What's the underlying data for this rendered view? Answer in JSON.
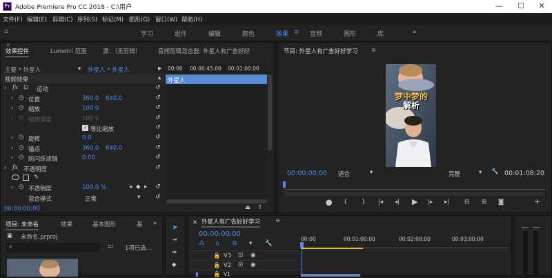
{
  "titlebar": {
    "title": "Adobe Premiere Pro CC 2018 - C:\\用户",
    "app_icon": "Pr",
    "minimize": "—",
    "maximize": "☐",
    "close": "✕"
  },
  "menu": [
    "文件(F)",
    "编辑(E)",
    "剪辑(C)",
    "序列(S)",
    "标记(M)",
    "图形(G)",
    "窗口(W)",
    "帮助(H)"
  ],
  "workspaces": [
    "学习",
    "组件",
    "编辑",
    "颜色",
    "效果",
    "音频",
    "图形",
    "库"
  ],
  "workspace_active": "效果",
  "effect_controls": {
    "tabs": [
      "效果控件",
      "Lumetri 范围",
      "源：（无剪辑）",
      "音频剪辑混合器: 外星人有广告好好"
    ],
    "master": "主要 * 外星人",
    "clip": "外星人 * 外星人",
    "timecodes": [
      "00:00",
      "00:00:45:00",
      "00:01:00:00"
    ],
    "clip_bar": "外星人",
    "video_effects": "视频效果",
    "motion": "运动",
    "position_label": "位置",
    "position_x": "360.0",
    "position_y": "640.0",
    "scale_label": "缩放",
    "scale_val": "100.0",
    "scale_width_label": "缩放宽度",
    "scale_width_val": "100.0",
    "uniform_scale": "等比缩放",
    "rotation_label": "旋转",
    "rotation_val": "0.0",
    "anchor_label": "锚点",
    "anchor_x": "360.0",
    "anchor_y": "640.0",
    "flicker_label": "防闪烁滤镜",
    "flicker_val": "0.00",
    "opacity_group": "不透明度",
    "opacity_label": "不透明度",
    "opacity_val": "100.0 %",
    "blend_label": "混合模式",
    "blend_val": "正常",
    "footer_time": "00:00:00:00"
  },
  "program": {
    "title": "节目: 外星人有广告好好学习",
    "caption_line1": "梦中梦的",
    "caption_line2": "解析",
    "timecode": "00:00:00:00",
    "fit": "适合",
    "quality": "完整",
    "duration": "00:01:08:20"
  },
  "project": {
    "tabs": [
      "项目: 未命名",
      "效果",
      "基本图形",
      "基"
    ],
    "file": "未命名.prproj",
    "selection": "1项已选..."
  },
  "timeline": {
    "title": "外星人有广告好好学习",
    "timecode": "00:00:00:00",
    "ruler": [
      "00:00",
      "00:01:00:00",
      "00:02:00:00",
      "00:03:00:00"
    ],
    "tracks": [
      "V3",
      "V2",
      "V1"
    ]
  },
  "colors": {
    "accent": "#4b8ef5",
    "panel": "#232323",
    "background": "#1d1d1d",
    "playhead": "#4b8ef5"
  }
}
